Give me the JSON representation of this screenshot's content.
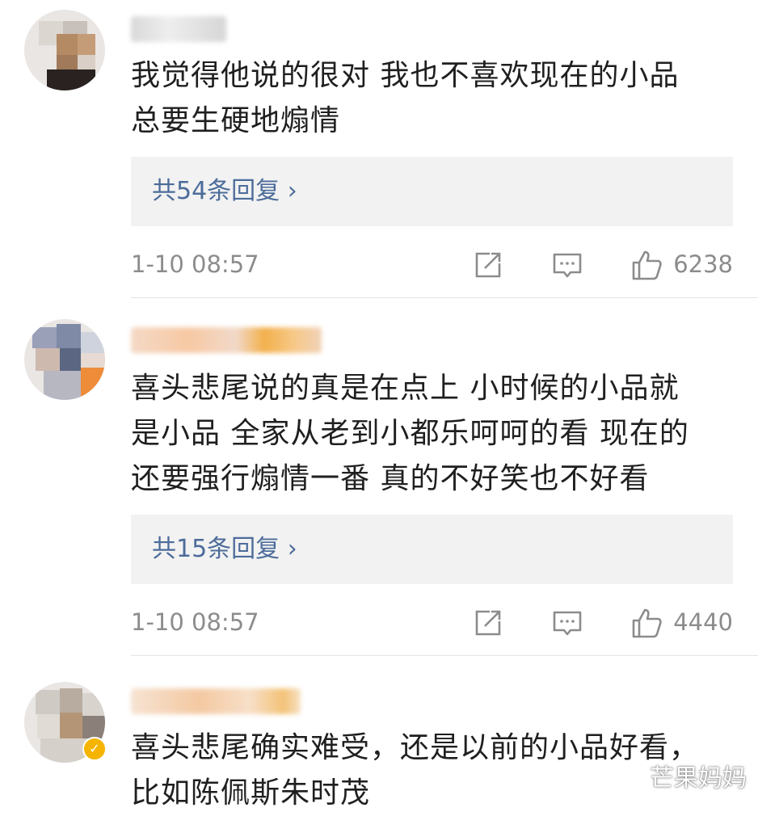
{
  "comments": [
    {
      "text_lines": [
        "我觉得他说的很对 我也不喜欢现在的小品",
        "总要生硬地煽情"
      ],
      "replies_label": "共54条回复 ›",
      "time": "1-10 08:57",
      "likes": "6238"
    },
    {
      "text_lines": [
        "喜头悲尾说的真是在点上 小时候的小品就",
        "是小品 全家从老到小都乐呵呵的看 现在的",
        "还要强行煽情一番 真的不好笑也不好看"
      ],
      "replies_label": "共15条回复 ›",
      "time": "1-10 08:57",
      "likes": "4440"
    },
    {
      "text_lines": [
        "喜头悲尾确实难受，还是以前的小品好看，",
        "比如陈佩斯朱时茂"
      ],
      "verified_icon": "check-badge-icon"
    }
  ],
  "icons": {
    "share": "share-edit-icon",
    "comment": "comment-bubble-icon",
    "like": "thumbs-up-icon"
  },
  "colors": {
    "link": "#4c6c9a",
    "meta": "#8c8c8c",
    "reply_bg": "#f2f2f2",
    "verified": "#f5b400"
  },
  "watermark": "芒果妈妈"
}
